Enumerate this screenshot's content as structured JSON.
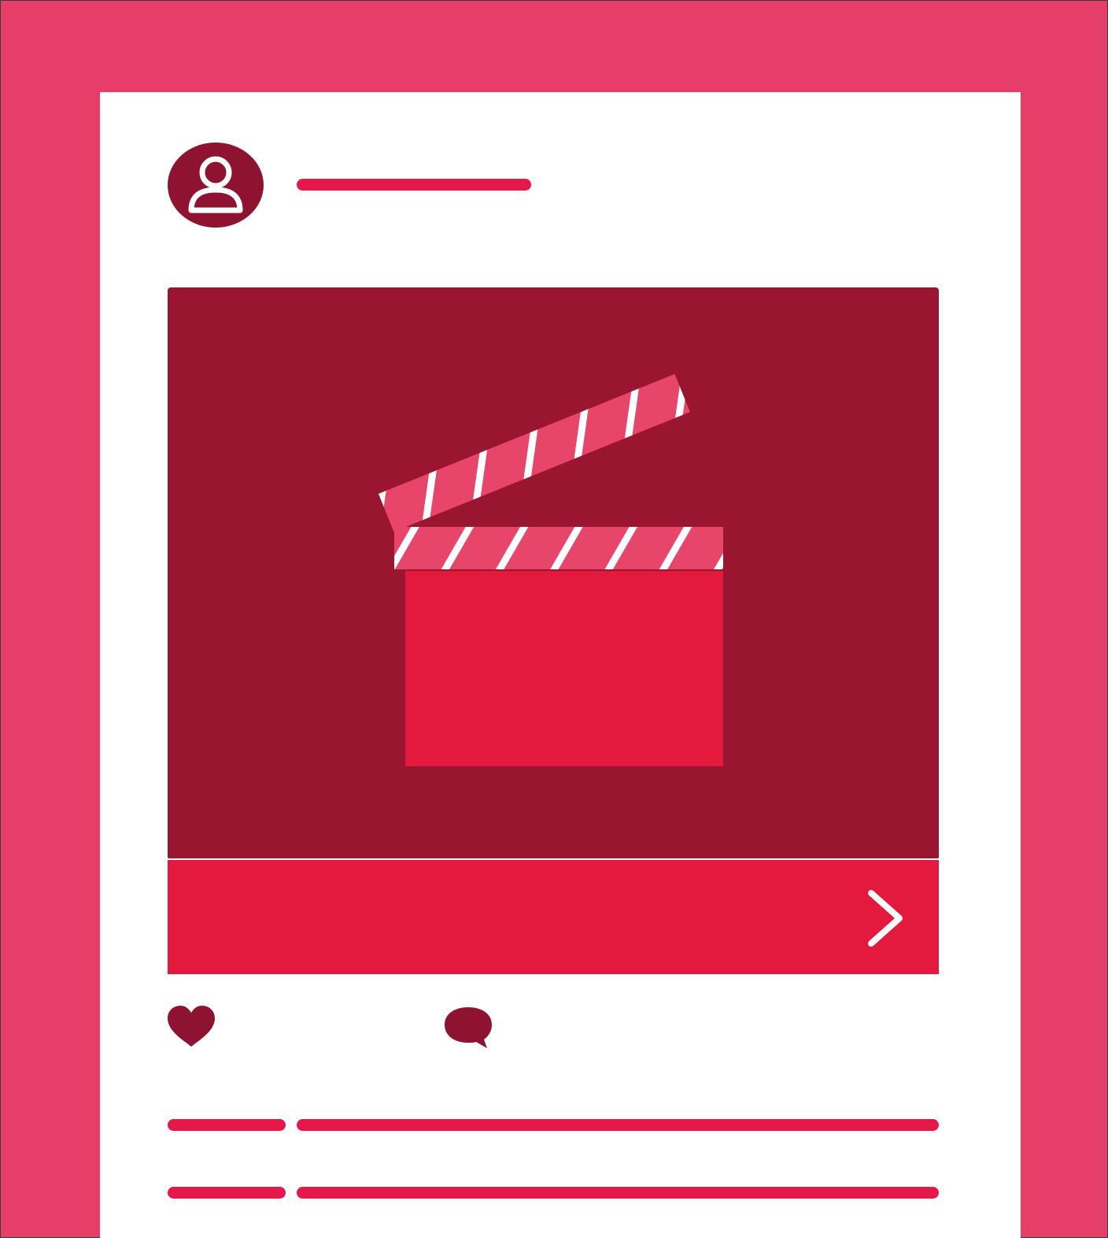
{
  "colors": {
    "background": "#e63e68",
    "card": "#ffffff",
    "accent": "#e5184a",
    "dark_accent": "#9a152f",
    "avatar": "#8e1330",
    "cta": "#e31a3e",
    "clapper_body": "#e31a3e",
    "clapper_stripe_bg": "#e8456a"
  },
  "post": {
    "avatar_icon": "user-avatar-icon",
    "media_icon": "clapperboard-icon",
    "cta_icon": "chevron-right-icon",
    "actions": [
      {
        "icon": "heart-icon"
      },
      {
        "icon": "comment-bubble-icon"
      }
    ]
  }
}
